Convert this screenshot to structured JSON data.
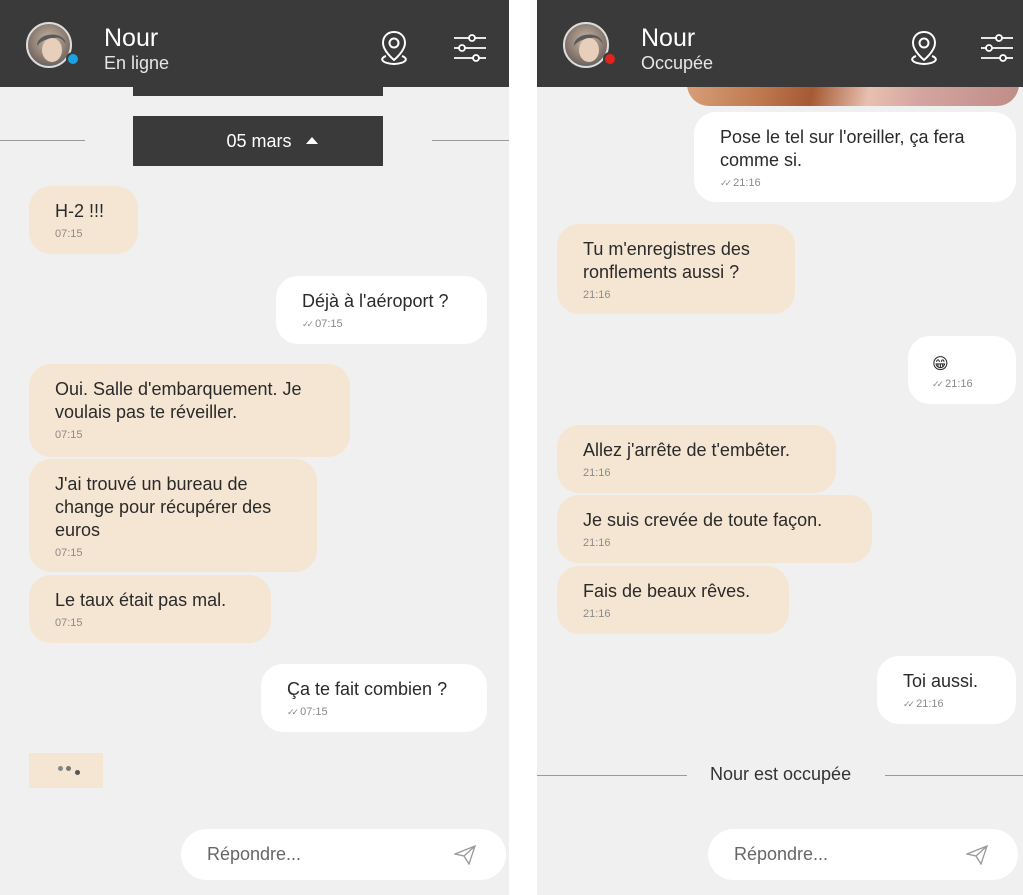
{
  "left": {
    "header": {
      "name": "Nour",
      "status": "En ligne",
      "status_color": "#1da1e0"
    },
    "date_pill": {
      "label": "05 mars"
    },
    "messages": [
      {
        "dir": "in",
        "text": "H-2 !!!",
        "time": "07:15"
      },
      {
        "dir": "out",
        "text": "Déjà à l'aéroport ?",
        "time": "07:15"
      },
      {
        "dir": "in",
        "text": "Oui. Salle d'embarquement. Je voulais pas te réveiller.",
        "time": "07:15"
      },
      {
        "dir": "in",
        "text": "J'ai trouvé un bureau de change pour récupérer des euros",
        "time": "07:15"
      },
      {
        "dir": "in",
        "text": "Le taux était pas mal.",
        "time": "07:15"
      },
      {
        "dir": "out",
        "text": "Ça te fait combien ?",
        "time": "07:15"
      }
    ],
    "reply": {
      "placeholder": "Répondre..."
    }
  },
  "right": {
    "header": {
      "name": "Nour",
      "status": "Occupée",
      "status_color": "#e0261c"
    },
    "messages": [
      {
        "dir": "out",
        "text": "Pose le tel sur l'oreiller, ça fera comme si.",
        "time": "21:16"
      },
      {
        "dir": "in",
        "text": "Tu m'enregistres des ronflements aussi ?",
        "time": "21:16"
      },
      {
        "dir": "out",
        "text": "😁",
        "time": "21:16"
      },
      {
        "dir": "in",
        "text": "Allez j'arrête de t'embêter.",
        "time": "21:16"
      },
      {
        "dir": "in",
        "text": "Je suis crevée de toute façon.",
        "time": "21:16"
      },
      {
        "dir": "in",
        "text": "Fais de beaux rêves.",
        "time": "21:16"
      },
      {
        "dir": "out",
        "text": "Toi aussi.",
        "time": "21:16"
      }
    ],
    "busy_notice": "Nour est occupée",
    "reply": {
      "placeholder": "Répondre..."
    }
  },
  "icons": {
    "location": "location-pin-icon",
    "settings": "sliders-icon",
    "send": "send-icon"
  },
  "colors": {
    "header_bg": "#3a3a3a",
    "incoming_bubble": "#f5e6d3",
    "outgoing_bubble": "#ffffff",
    "chat_bg": "#f0f0f0"
  }
}
